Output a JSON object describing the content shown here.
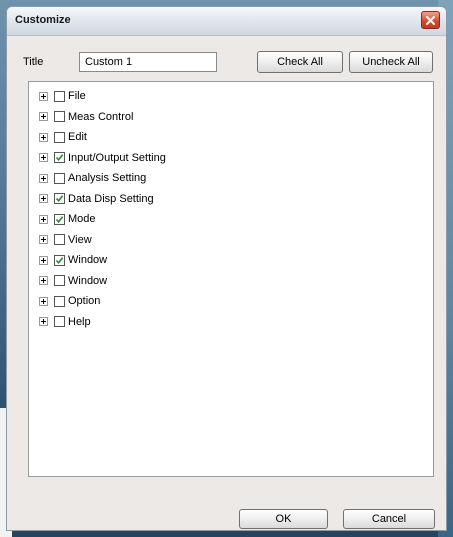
{
  "window": {
    "title": "Customize"
  },
  "form": {
    "title_label": "Title",
    "title_value": "Custom 1",
    "check_all_label": "Check All",
    "uncheck_all_label": "Uncheck All"
  },
  "tree": {
    "items": [
      {
        "label": "File",
        "checked": false
      },
      {
        "label": "Meas Control",
        "checked": false
      },
      {
        "label": "Edit",
        "checked": false
      },
      {
        "label": "Input/Output Setting",
        "checked": true
      },
      {
        "label": "Analysis Setting",
        "checked": false
      },
      {
        "label": "Data Disp Setting",
        "checked": true
      },
      {
        "label": "Mode",
        "checked": true
      },
      {
        "label": "View",
        "checked": false
      },
      {
        "label": "Window",
        "checked": true
      },
      {
        "label": "Window",
        "checked": false
      },
      {
        "label": "Option",
        "checked": false
      },
      {
        "label": "Help",
        "checked": false
      }
    ]
  },
  "footer": {
    "ok_label": "OK",
    "cancel_label": "Cancel"
  },
  "icons": {
    "close": "close-icon",
    "expand": "plus-expander-icon",
    "check": "checkmark-icon"
  },
  "colors": {
    "close_button": "#d6482b",
    "check_mark": "#2a8a2a"
  }
}
